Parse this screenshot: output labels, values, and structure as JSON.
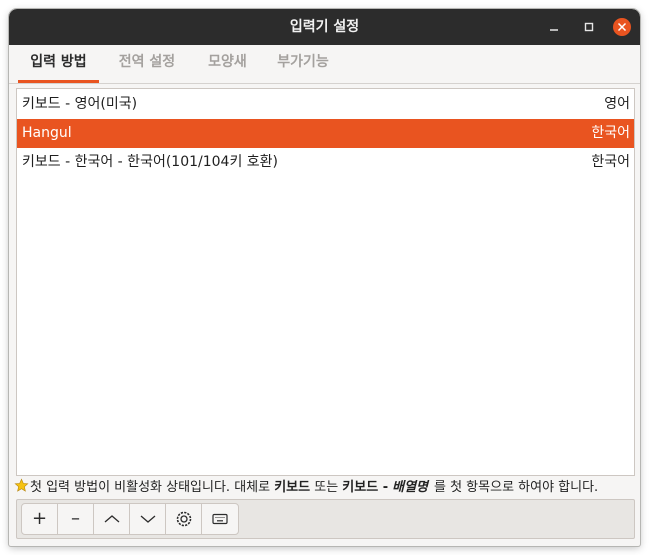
{
  "window": {
    "title": "입력기 설정"
  },
  "tabs": [
    {
      "label": "입력 방법",
      "active": true
    },
    {
      "label": "전역 설정",
      "active": false
    },
    {
      "label": "모양새",
      "active": false
    },
    {
      "label": "부가기능",
      "active": false
    }
  ],
  "input_methods": [
    {
      "name": "키보드 - 영어(미국)",
      "language": "영어",
      "selected": false
    },
    {
      "name": "Hangul",
      "language": "한국어",
      "selected": true
    },
    {
      "name": "키보드 - 한국어 - 한국어(101/104키 호환)",
      "language": "한국어",
      "selected": false
    }
  ],
  "hint": {
    "part1": "첫 입력 방법이 비활성화 상태입니다. 대체로 ",
    "bold1": "키보드",
    "part2": " 또는 ",
    "bold2": "키보드 -",
    "italic": "배열명",
    "part3": "를 첫 항목으로 하여야 합니다."
  },
  "toolbar": {
    "add_label": "+",
    "remove_label": "–",
    "icons": [
      "move-up-icon",
      "move-down-icon",
      "configure-icon",
      "keyboard-layout-icon"
    ]
  },
  "colors": {
    "accent": "#e95420",
    "titlebar": "#2c2c2c",
    "close": "#e95420"
  }
}
